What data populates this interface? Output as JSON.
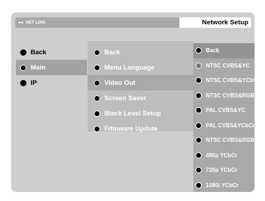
{
  "titlebar": {
    "brand": "NET LINK",
    "title": "Network Setup"
  },
  "menu_level1": [
    {
      "label": "Back",
      "selected": false
    },
    {
      "label": "Main",
      "selected": true
    },
    {
      "label": "IP",
      "selected": false
    }
  ],
  "menu_level2": [
    {
      "label": "Back",
      "selected": false
    },
    {
      "label": "Menu Language",
      "selected": false
    },
    {
      "label": "Video Out",
      "selected": true
    },
    {
      "label": "Screen Saver",
      "selected": false
    },
    {
      "label": "Black Level Setup",
      "selected": false
    },
    {
      "label": "Fifmware Update",
      "selected": false
    }
  ],
  "menu_level3": [
    {
      "label": "Back",
      "selected": true
    },
    {
      "label": "NTSC CVBS&YC",
      "selected": false
    },
    {
      "label": "NTSC CVBS&YCbCr",
      "selected": false
    },
    {
      "label": "NTSC CVBS&RGB",
      "selected": false
    },
    {
      "label": "PAL CVBS&YC",
      "selected": false
    },
    {
      "label": "PAL CVBS&YCbCr",
      "selected": false
    },
    {
      "label": "NTSC CVBS&RGB",
      "selected": false
    },
    {
      "label": "480p YCbCr",
      "selected": false
    },
    {
      "label": "720p YCbCr",
      "selected": false
    },
    {
      "label": "1080i YCbCr",
      "selected": false
    }
  ],
  "colors": {
    "panel": "#cecece",
    "level2_bg": "#bdbdbd",
    "level3_bg": "#a9a9a9",
    "highlight": "#a2a2a2"
  }
}
